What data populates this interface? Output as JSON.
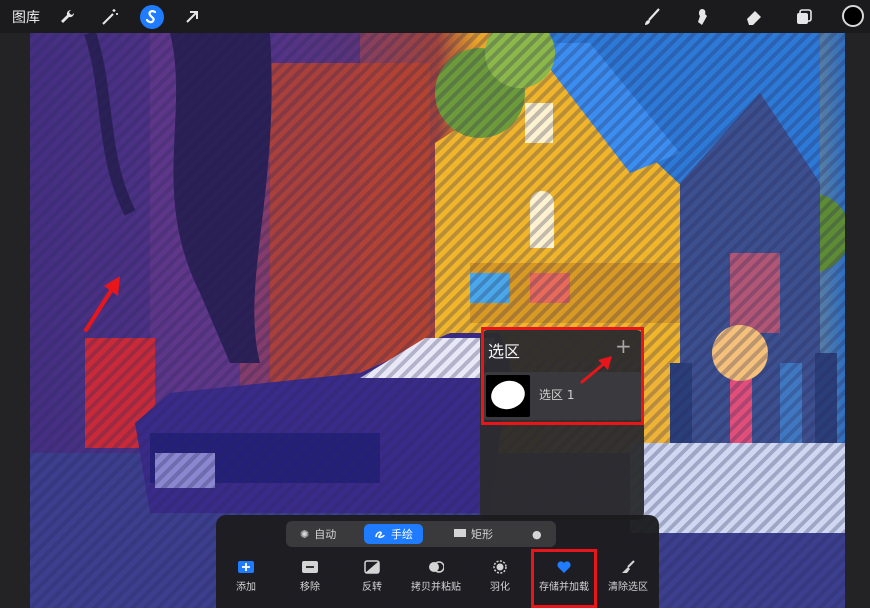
{
  "topbar": {
    "gallery_label": "图库"
  },
  "selection_panel": {
    "title": "选区",
    "add_symbol": "+",
    "items": [
      {
        "label": "选区 1"
      }
    ]
  },
  "selection_toolbar": {
    "modes": [
      {
        "label": "自动",
        "icon": "gear-icon"
      },
      {
        "label": "手绘",
        "icon": "freehand-icon",
        "active": true
      },
      {
        "label": "矩形",
        "icon": "rectangle-icon"
      },
      {
        "label": "",
        "icon": "ellipse-icon"
      }
    ],
    "actions": [
      {
        "label": "添加",
        "icon": "add-icon"
      },
      {
        "label": "移除",
        "icon": "remove-icon"
      },
      {
        "label": "反转",
        "icon": "invert-icon"
      },
      {
        "label": "拷贝并粘贴",
        "icon": "copy-paste-icon"
      },
      {
        "label": "羽化",
        "icon": "feather-icon"
      },
      {
        "label": "存储并加载",
        "icon": "heart-icon"
      },
      {
        "label": "清除选区",
        "icon": "brush-clear-icon"
      }
    ]
  },
  "colors": {
    "accent": "#1f7cff",
    "highlight": "#e8161a",
    "current_color": "#000000"
  }
}
